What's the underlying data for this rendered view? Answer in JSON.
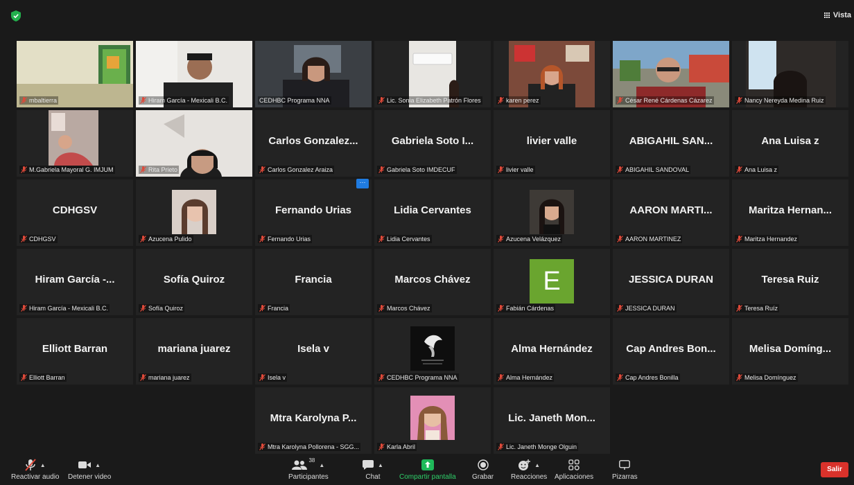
{
  "top": {
    "view_label": "Vista"
  },
  "tiles": [
    {
      "label": "mbaltierra",
      "big": ""
    },
    {
      "label": "Hiram García - Mexicali B.C.",
      "big": ""
    },
    {
      "label": "CEDHBC Programa NNA",
      "big": ""
    },
    {
      "label": "Lic. Sonia Elizabeth Patrón Flores",
      "big": ""
    },
    {
      "label": "karen perez",
      "big": ""
    },
    {
      "label": "César René Cárdenas Cázarez",
      "big": ""
    },
    {
      "label": "Nancy Nereyda Medina Ruiz",
      "big": ""
    },
    {
      "label": "M.Gabriela Mayoral G. IMJUM",
      "big": ""
    },
    {
      "label": "Rita Prieto",
      "big": ""
    },
    {
      "label": "Carlos Gonzalez Araiza",
      "big": "Carlos Gonzalez..."
    },
    {
      "label": "Gabriela Soto IMDECUF",
      "big": "Gabriela Soto I..."
    },
    {
      "label": "livier valle",
      "big": "livier valle"
    },
    {
      "label": "ABIGAHIL SANDOVAL",
      "big": "ABIGAHIL SAN..."
    },
    {
      "label": "Ana Luisa z",
      "big": "Ana Luisa z"
    },
    {
      "label": "CDHGSV",
      "big": "CDHGSV"
    },
    {
      "label": "Azucena Pulido",
      "big": ""
    },
    {
      "label": "Fernando Urias",
      "big": "Fernando Urias"
    },
    {
      "label": "Lidia Cervantes",
      "big": "Lidia Cervantes"
    },
    {
      "label": "Azucena Velázquez",
      "big": ""
    },
    {
      "label": "AARON MARTINEZ",
      "big": "AARON MARTI..."
    },
    {
      "label": "Maritza Hernandez",
      "big": "Maritza Hernan..."
    },
    {
      "label": "Hiram García - Mexicali B.C.",
      "big": "Hiram García -..."
    },
    {
      "label": "Sofía Quiroz",
      "big": "Sofía Quiroz"
    },
    {
      "label": "Francia",
      "big": "Francia"
    },
    {
      "label": "Marcos Chávez",
      "big": "Marcos Chávez"
    },
    {
      "label": "Fabián Cárdenas",
      "big": "",
      "avatar": "E"
    },
    {
      "label": "JESSICA DURAN",
      "big": "JESSICA DURAN"
    },
    {
      "label": "Teresa Ruíz",
      "big": "Teresa Ruiz"
    },
    {
      "label": "Elliott Barran",
      "big": "Elliott Barran"
    },
    {
      "label": "mariana juarez",
      "big": "mariana juarez"
    },
    {
      "label": "Isela v",
      "big": "Isela v"
    },
    {
      "label": "CEDHBC Programa NNA",
      "big": ""
    },
    {
      "label": "Alma Hernández",
      "big": "Alma Hernández"
    },
    {
      "label": "Cap Andres Bonilla",
      "big": "Cap Andres Bon..."
    },
    {
      "label": "Melisa Domínguez",
      "big": "Melisa Domíng..."
    },
    {
      "label": "Mtra Karolyna Pollorena - SGG...",
      "big": "Mtra Karolyna P..."
    },
    {
      "label": "Karla Abril",
      "big": ""
    },
    {
      "label": "Lic. Janeth Monge Olguin",
      "big": "Lic. Janeth Mon..."
    }
  ],
  "toolbar": {
    "mute": "Reactivar audio",
    "video": "Detener video",
    "participants": "Participantes",
    "participants_count": "38",
    "chat": "Chat",
    "share": "Compartir pantalla",
    "record": "Grabar",
    "reactions": "Reacciones",
    "apps": "Aplicaciones",
    "whiteboards": "Pizarras",
    "leave": "Salir"
  },
  "colors": {
    "accent_share": "#1fb95a",
    "active_speaker": "#c8d65a",
    "leave": "#d9322b",
    "muted": "#e04a3a"
  }
}
